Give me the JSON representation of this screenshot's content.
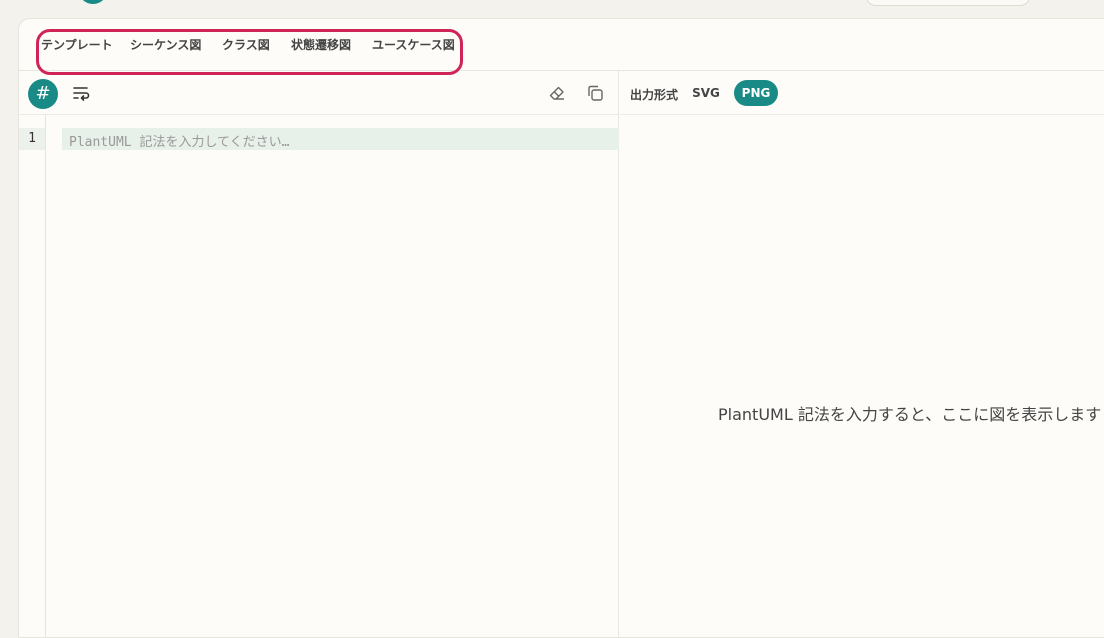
{
  "templates": {
    "label": "テンプレート",
    "items": [
      "シーケンス図",
      "クラス図",
      "状態遷移図",
      "ユースケース図"
    ]
  },
  "editor": {
    "hash_icon": "#",
    "line_number": "1",
    "placeholder": "PlantUML 記法を入力してください…",
    "icons": {
      "format": "hash-icon",
      "wrap": "wrap-lines-icon",
      "clear": "eraser-icon",
      "copy": "copy-icon"
    }
  },
  "preview": {
    "format_label": "出力形式",
    "formats": [
      "SVG",
      "PNG"
    ],
    "selected_format": "PNG",
    "empty_message": "PlantUML 記法を入力すると、ここに図を表示します"
  },
  "colors": {
    "accent": "#1a8a86",
    "highlight_border": "#d02456"
  }
}
